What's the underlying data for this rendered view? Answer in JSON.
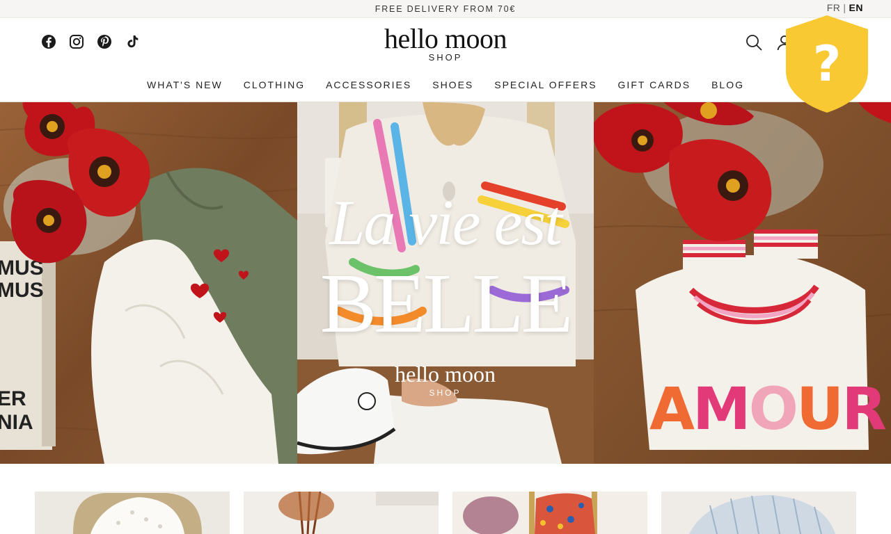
{
  "announcement": {
    "text": "FREE DELIVERY FROM 70€"
  },
  "language": {
    "options": [
      "FR",
      "EN"
    ],
    "separator": "|",
    "active": "EN"
  },
  "header": {
    "logo_main": "hello moon",
    "logo_sub": "SHOP",
    "socials": [
      "facebook-icon",
      "instagram-icon",
      "pinterest-icon",
      "tiktok-icon"
    ],
    "icons": [
      "search-icon",
      "account-icon"
    ]
  },
  "nav": {
    "items": [
      "WHAT'S NEW",
      "CLOTHING",
      "ACCESSORIES",
      "SHOES",
      "SPECIAL OFFERS",
      "GIFT CARDS",
      "BLOG"
    ]
  },
  "help_widget": {
    "symbol": "?",
    "color": "#f9c933"
  },
  "hero": {
    "script_text": "La vie est",
    "big_text": "BELLE",
    "brand": "hello moon",
    "brand_sub": "SHOP",
    "sweater_text": "AMOUR",
    "book_text": "MUS\nMUS\nER\nNIA"
  },
  "thumbnails": [
    "lace-blouse-thumbnail",
    "dried-flowers-thumbnail",
    "floral-blouse-thumbnail",
    "striped-shirt-thumbnail"
  ],
  "colors": {
    "accent_yellow": "#f9c933",
    "topbar_bg": "#f6f5f3",
    "wood": "#8a5a35",
    "tulip_red": "#c0141a"
  }
}
